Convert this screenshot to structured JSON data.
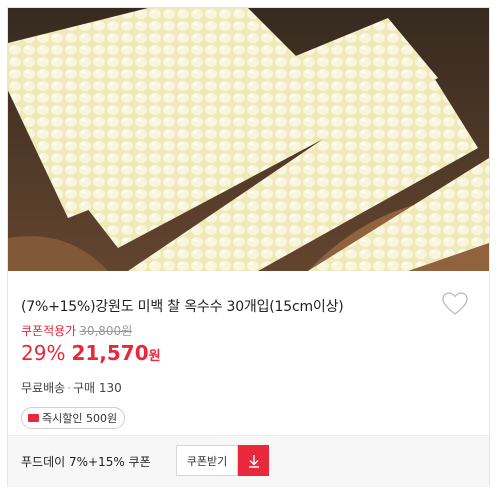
{
  "product": {
    "title": "(7%+15%)강원도 미백 찰 옥수수 30개입(15cm이상)",
    "orig_label": "쿠폰적용가",
    "orig_price": "30,800원",
    "discount": "29%",
    "price": "21,570",
    "currency": "원",
    "shipping": "무료배송",
    "purchase": "구매 130",
    "badge": "즉시할인 500원"
  },
  "coupon": {
    "text": "푸드데이 7%+15% 쿠폰",
    "button_label": "쿠폰받기"
  },
  "colors": {
    "accent": "#e8293b",
    "corn": "#f3eec4",
    "basket": "#5a3a22"
  },
  "icons": [
    "heart-icon",
    "coupon-icon",
    "download-icon"
  ]
}
